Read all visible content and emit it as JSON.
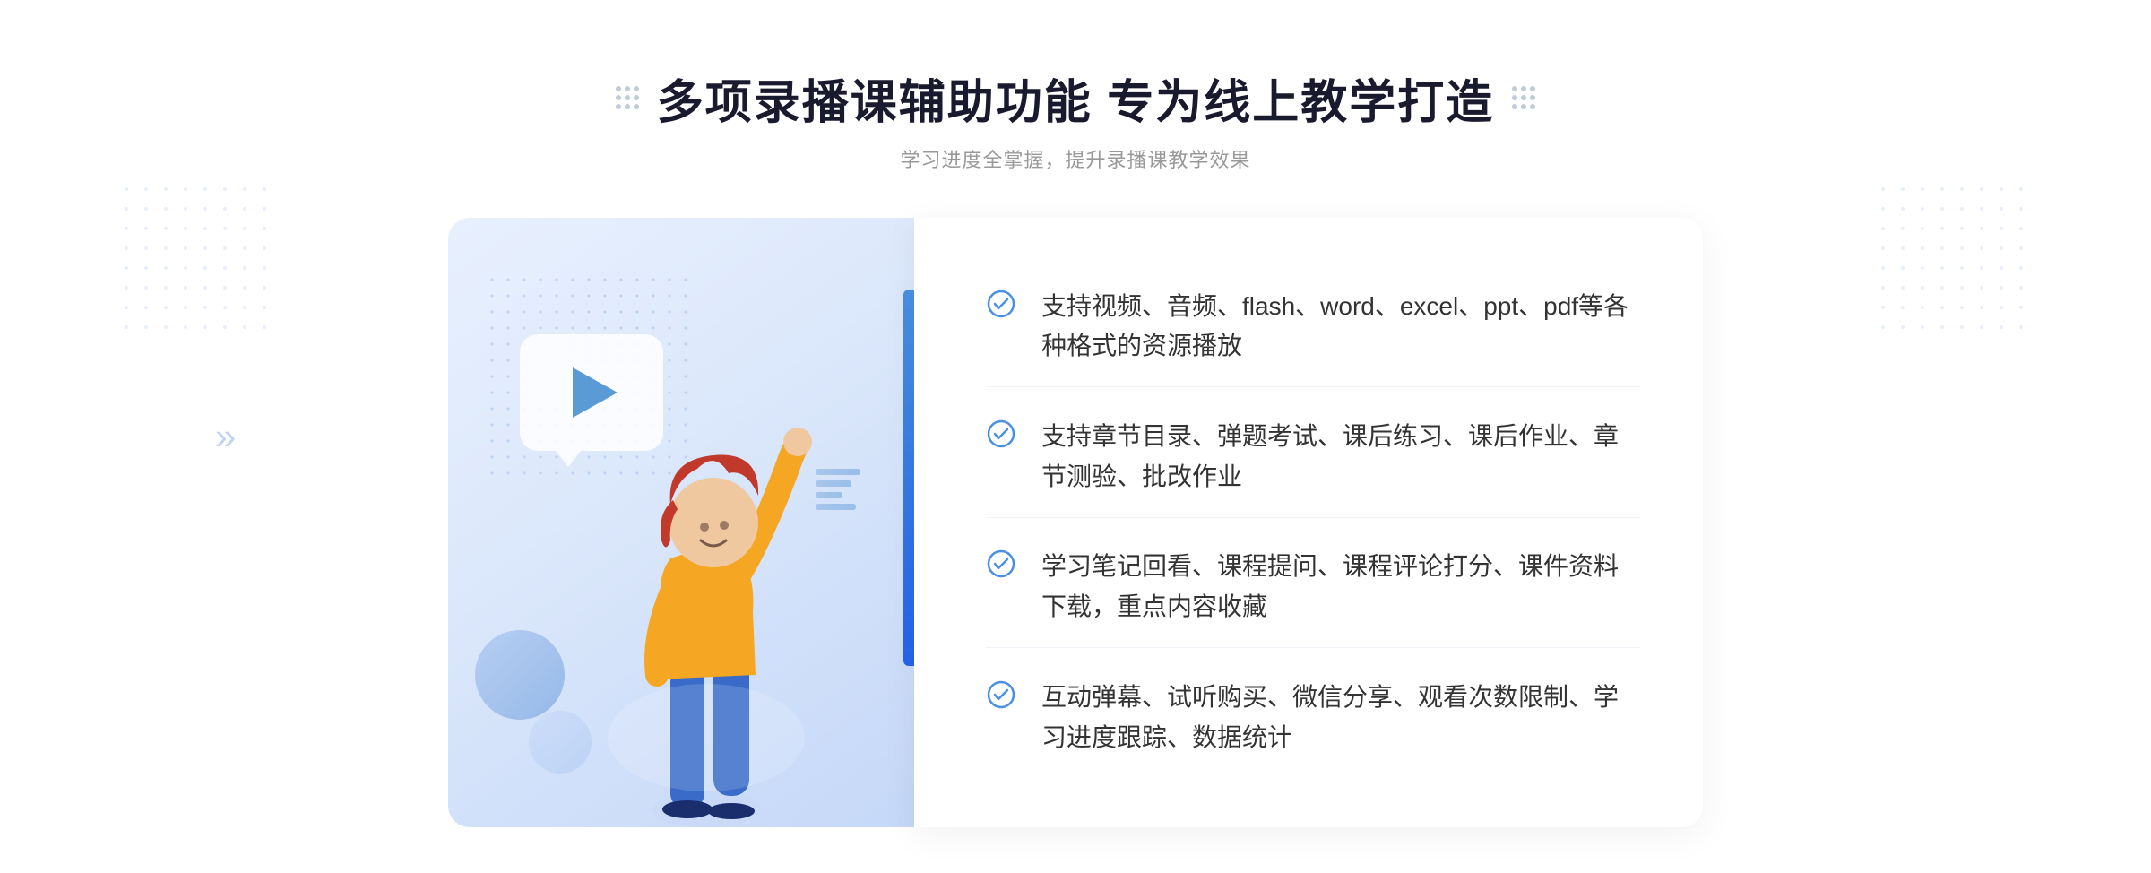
{
  "header": {
    "title": "多项录播课辅助功能 专为线上教学打造",
    "subtitle": "学习进度全掌握，提升录播课教学效果"
  },
  "features": [
    {
      "id": 1,
      "text": "支持视频、音频、flash、word、excel、ppt、pdf等各种格式的资源播放"
    },
    {
      "id": 2,
      "text": "支持章节目录、弹题考试、课后练习、课后作业、章节测验、批改作业"
    },
    {
      "id": 3,
      "text": "学习笔记回看、课程提问、课程评论打分、课件资料下载，重点内容收藏"
    },
    {
      "id": 4,
      "text": "互动弹幕、试听购买、微信分享、观看次数限制、学习进度跟踪、数据统计"
    }
  ],
  "decorations": {
    "left_arrows": "《",
    "dot_decoration_label": "dot-grid"
  },
  "colors": {
    "primary": "#4a90e2",
    "title": "#1a1a2e",
    "subtitle": "#999999",
    "feature_text": "#333333",
    "bg_panel": "#e8f0fe"
  }
}
